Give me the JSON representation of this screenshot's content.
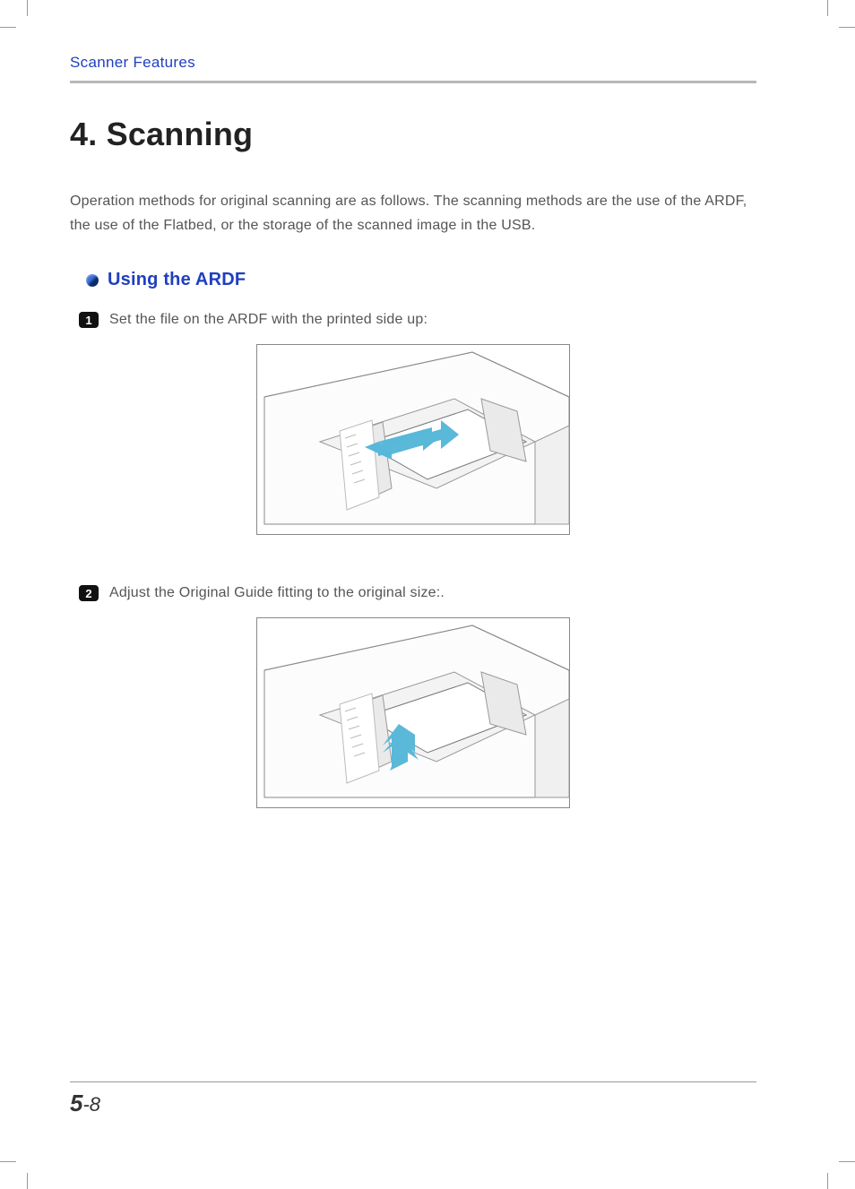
{
  "header": {
    "running_head": "Scanner Features"
  },
  "title": "4. Scanning",
  "intro": "Operation methods for original scanning are as follows. The scanning methods are the use of the ARDF, the use of the Flatbed, or the storage of the scanned image in the USB.",
  "section": {
    "heading": "Using the ARDF",
    "steps": [
      {
        "num": "1",
        "text": "Set the file on the ARDF with the printed side up:"
      },
      {
        "num": "2",
        "text": "Adjust the Original Guide fitting to the original size:."
      }
    ]
  },
  "footer": {
    "chapter": "5",
    "page": "8"
  }
}
